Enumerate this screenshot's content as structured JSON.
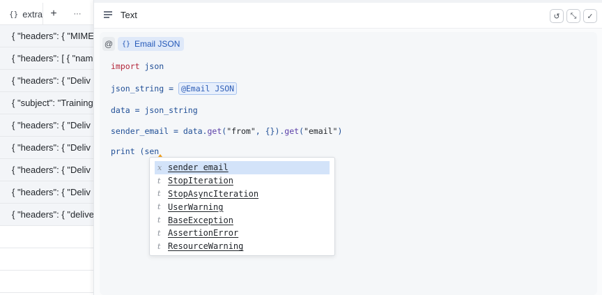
{
  "table": {
    "column_header": "extra",
    "column_icon": "{}",
    "add_label": "+",
    "more_label": "···",
    "rows": [
      "{ \"headers\": { \"MIME",
      "{ \"headers\": [ { \"nam",
      "{ \"headers\": { \"Deliv",
      "{ \"subject\": \"Training",
      "{ \"headers\": { \"Deliv",
      "{ \"headers\": { \"Deliv",
      "{ \"headers\": { \"Deliv",
      "{ \"headers\": { \"Deliv",
      "{ \"headers\": { \"delive"
    ]
  },
  "panel": {
    "title": "Text",
    "buttons": {
      "reset": "↺",
      "collapse": "⤡",
      "confirm": "✓"
    }
  },
  "editor": {
    "at_label": "@",
    "variable_chip": {
      "icon": "{}",
      "label": "Email JSON"
    },
    "code": {
      "line1_kw": "import",
      "line1_rest": " json",
      "line2_prefix": "json_string = ",
      "line2_chip": "@Email JSON",
      "line3": "data = json_string",
      "line4_a": "sender_email = data.",
      "line4_get1": "get",
      "line4_b": "(",
      "line4_str1": "\"from\"",
      "line4_c": ", {}).",
      "line4_get2": "get",
      "line4_d": "(",
      "line4_str2": "\"email\"",
      "line4_e": ")",
      "line5": "print (sen"
    },
    "autocomplete": [
      {
        "kind": "x",
        "label": "sender_email",
        "selected": true
      },
      {
        "kind": "t",
        "label": "StopIteration",
        "selected": false
      },
      {
        "kind": "t",
        "label": "StopAsyncIteration",
        "selected": false
      },
      {
        "kind": "t",
        "label": "UserWarning",
        "selected": false
      },
      {
        "kind": "t",
        "label": "BaseException",
        "selected": false
      },
      {
        "kind": "t",
        "label": "AssertionError",
        "selected": false
      },
      {
        "kind": "t",
        "label": "ResourceWarning",
        "selected": false
      }
    ]
  },
  "colors": {
    "accent": "#2358b8",
    "keyword": "#b3263a",
    "selection": "#d3e3f9"
  }
}
